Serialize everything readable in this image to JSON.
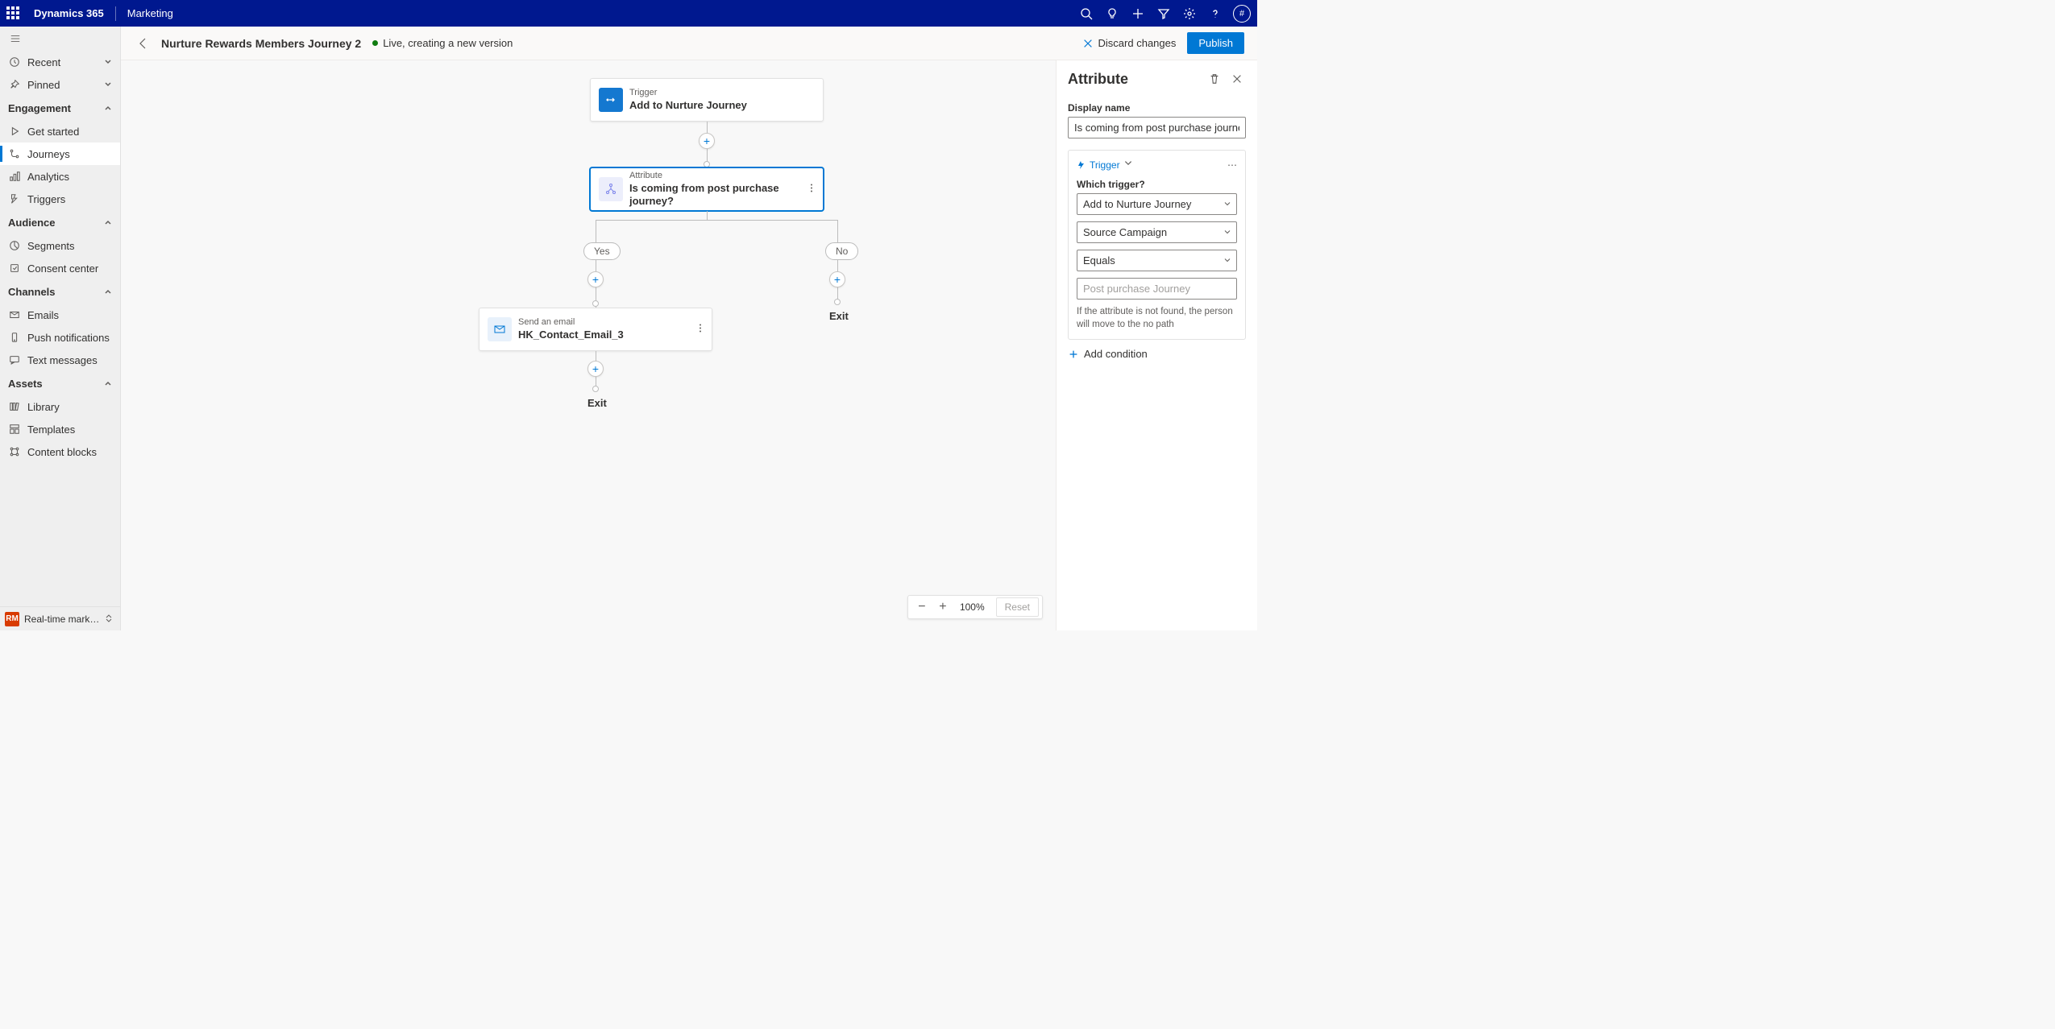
{
  "navbar": {
    "brand": "Dynamics 365",
    "area": "Marketing",
    "avatar": "#"
  },
  "sidebar": {
    "recent": "Recent",
    "pinned": "Pinned",
    "sections": {
      "engagement": "Engagement",
      "audience": "Audience",
      "channels": "Channels",
      "assets": "Assets"
    },
    "items": {
      "getStarted": "Get started",
      "journeys": "Journeys",
      "analytics": "Analytics",
      "triggers": "Triggers",
      "segments": "Segments",
      "consent": "Consent center",
      "emails": "Emails",
      "push": "Push notifications",
      "text": "Text messages",
      "library": "Library",
      "templates": "Templates",
      "contentBlocks": "Content blocks"
    },
    "footer": {
      "badge": "RM",
      "label": "Real-time marketi..."
    }
  },
  "cmdbar": {
    "title": "Nurture Rewards Members Journey 2",
    "status": "Live, creating a new version",
    "discard": "Discard changes",
    "publish": "Publish"
  },
  "flow": {
    "trigger": {
      "type": "Trigger",
      "title": "Add to Nurture Journey"
    },
    "attr": {
      "type": "Attribute",
      "title": "Is coming from post purchase journey?"
    },
    "email": {
      "type": "Send an email",
      "title": "HK_Contact_Email_3"
    },
    "yes": "Yes",
    "no": "No",
    "exit": "Exit"
  },
  "zoom": {
    "value": "100%",
    "reset": "Reset"
  },
  "props": {
    "title": "Attribute",
    "displayNameLabel": "Display name",
    "displayNameValue": "Is coming from post purchase journey?",
    "triggerHead": "Trigger",
    "whichTrigger": "Which trigger?",
    "triggerOpt": "Add to Nurture Journey",
    "sourceOpt": "Source Campaign",
    "equalsOpt": "Equals",
    "valuePlaceholder": "Post purchase Journey",
    "helpText": "If the attribute is not found, the person will move to the no path",
    "addCondition": "Add condition"
  }
}
